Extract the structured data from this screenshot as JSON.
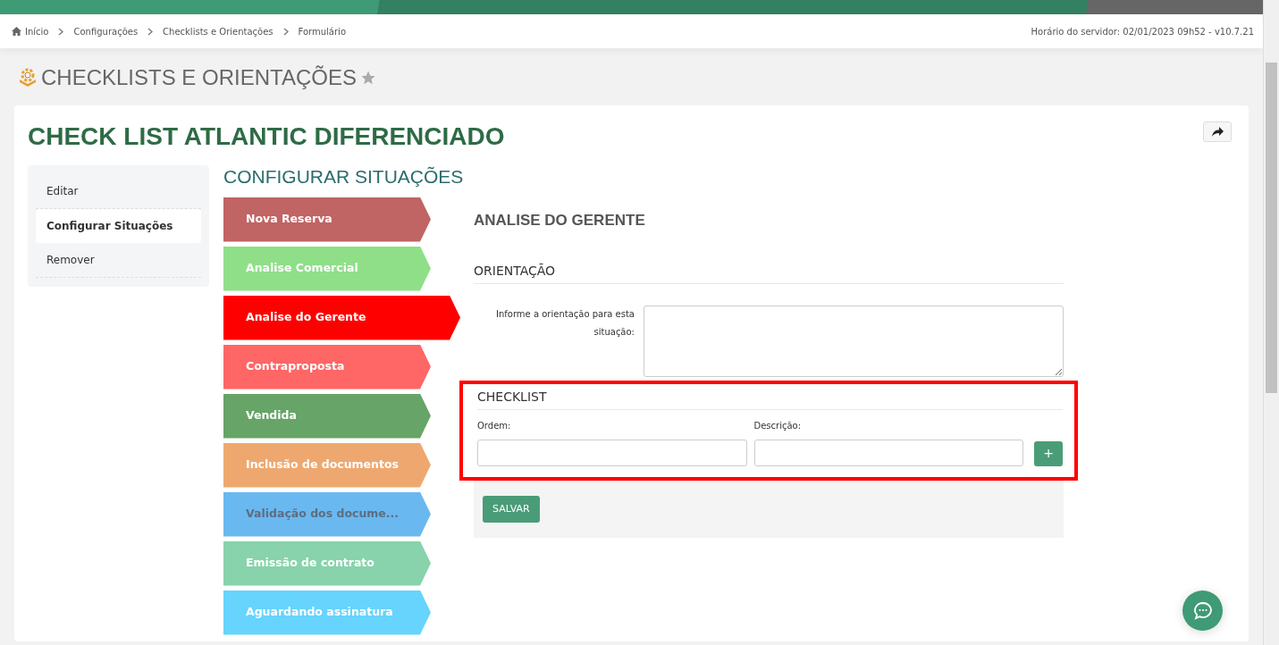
{
  "breadcrumb": {
    "items": [
      {
        "label": "Início",
        "kind": "home"
      },
      {
        "label": "Configurações",
        "kind": "link"
      },
      {
        "label": "Checklists e Orientações",
        "kind": "link"
      },
      {
        "label": "Formulário",
        "kind": "current"
      }
    ],
    "server_info": "Horário do servidor: 02/01/2023 09h52 - v10.7.21"
  },
  "page_title": "CHECKLISTS E ORIENTAÇÕES",
  "favorite": false,
  "card": {
    "title": "CHECK LIST ATLANTIC DIFERENCIADO",
    "menu": [
      {
        "label": "Editar",
        "selected": false
      },
      {
        "label": "Configurar Situações",
        "selected": true
      },
      {
        "label": "Remover",
        "selected": false
      }
    ],
    "section_title": "CONFIGURAR SITUAÇÕES",
    "stages": [
      {
        "label": "Nova Reserva",
        "color": "#c16464",
        "selected": false,
        "dimmed": false
      },
      {
        "label": "Analise Comercial",
        "color": "#8fdf88",
        "selected": false,
        "dimmed": false
      },
      {
        "label": "Analise do Gerente",
        "color": "#ff0000",
        "selected": true,
        "dimmed": false
      },
      {
        "label": "Contraproposta",
        "color": "#ff6666",
        "selected": false,
        "dimmed": false
      },
      {
        "label": "Vendida",
        "color": "#66a467",
        "selected": false,
        "dimmed": false
      },
      {
        "label": "Inclusão de documentos",
        "color": "#eea86f",
        "selected": false,
        "dimmed": false
      },
      {
        "label": "Validação dos docume...",
        "color": "#6ab8f0",
        "selected": false,
        "dimmed": true
      },
      {
        "label": "Emissão de contrato",
        "color": "#88d3ab",
        "selected": false,
        "dimmed": false
      },
      {
        "label": "Aguardando assinatura",
        "color": "#66d4fd",
        "selected": false,
        "dimmed": false
      }
    ],
    "detail": {
      "title": "ANALISE DO GERENTE",
      "orientation_heading": "ORIENTAÇÃO",
      "orientation_label": "Informe a orientação para esta situação:",
      "checklist": {
        "heading": "CHECKLIST",
        "highlighted": true,
        "order_label": "Ordem:",
        "description_label": "Descrição:",
        "add_button": "+"
      },
      "save_button": "SALVAR"
    }
  }
}
